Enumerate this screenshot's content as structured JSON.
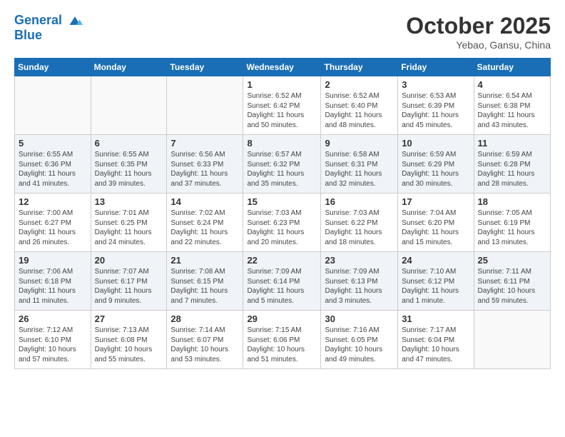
{
  "header": {
    "logo_line1": "General",
    "logo_line2": "Blue",
    "month": "October 2025",
    "location": "Yebao, Gansu, China"
  },
  "weekdays": [
    "Sunday",
    "Monday",
    "Tuesday",
    "Wednesday",
    "Thursday",
    "Friday",
    "Saturday"
  ],
  "weeks": [
    [
      {
        "day": "",
        "sunrise": "",
        "sunset": "",
        "daylight": ""
      },
      {
        "day": "",
        "sunrise": "",
        "sunset": "",
        "daylight": ""
      },
      {
        "day": "",
        "sunrise": "",
        "sunset": "",
        "daylight": ""
      },
      {
        "day": "1",
        "sunrise": "Sunrise: 6:52 AM",
        "sunset": "Sunset: 6:42 PM",
        "daylight": "Daylight: 11 hours and 50 minutes."
      },
      {
        "day": "2",
        "sunrise": "Sunrise: 6:52 AM",
        "sunset": "Sunset: 6:40 PM",
        "daylight": "Daylight: 11 hours and 48 minutes."
      },
      {
        "day": "3",
        "sunrise": "Sunrise: 6:53 AM",
        "sunset": "Sunset: 6:39 PM",
        "daylight": "Daylight: 11 hours and 45 minutes."
      },
      {
        "day": "4",
        "sunrise": "Sunrise: 6:54 AM",
        "sunset": "Sunset: 6:38 PM",
        "daylight": "Daylight: 11 hours and 43 minutes."
      }
    ],
    [
      {
        "day": "5",
        "sunrise": "Sunrise: 6:55 AM",
        "sunset": "Sunset: 6:36 PM",
        "daylight": "Daylight: 11 hours and 41 minutes."
      },
      {
        "day": "6",
        "sunrise": "Sunrise: 6:55 AM",
        "sunset": "Sunset: 6:35 PM",
        "daylight": "Daylight: 11 hours and 39 minutes."
      },
      {
        "day": "7",
        "sunrise": "Sunrise: 6:56 AM",
        "sunset": "Sunset: 6:33 PM",
        "daylight": "Daylight: 11 hours and 37 minutes."
      },
      {
        "day": "8",
        "sunrise": "Sunrise: 6:57 AM",
        "sunset": "Sunset: 6:32 PM",
        "daylight": "Daylight: 11 hours and 35 minutes."
      },
      {
        "day": "9",
        "sunrise": "Sunrise: 6:58 AM",
        "sunset": "Sunset: 6:31 PM",
        "daylight": "Daylight: 11 hours and 32 minutes."
      },
      {
        "day": "10",
        "sunrise": "Sunrise: 6:59 AM",
        "sunset": "Sunset: 6:29 PM",
        "daylight": "Daylight: 11 hours and 30 minutes."
      },
      {
        "day": "11",
        "sunrise": "Sunrise: 6:59 AM",
        "sunset": "Sunset: 6:28 PM",
        "daylight": "Daylight: 11 hours and 28 minutes."
      }
    ],
    [
      {
        "day": "12",
        "sunrise": "Sunrise: 7:00 AM",
        "sunset": "Sunset: 6:27 PM",
        "daylight": "Daylight: 11 hours and 26 minutes."
      },
      {
        "day": "13",
        "sunrise": "Sunrise: 7:01 AM",
        "sunset": "Sunset: 6:25 PM",
        "daylight": "Daylight: 11 hours and 24 minutes."
      },
      {
        "day": "14",
        "sunrise": "Sunrise: 7:02 AM",
        "sunset": "Sunset: 6:24 PM",
        "daylight": "Daylight: 11 hours and 22 minutes."
      },
      {
        "day": "15",
        "sunrise": "Sunrise: 7:03 AM",
        "sunset": "Sunset: 6:23 PM",
        "daylight": "Daylight: 11 hours and 20 minutes."
      },
      {
        "day": "16",
        "sunrise": "Sunrise: 7:03 AM",
        "sunset": "Sunset: 6:22 PM",
        "daylight": "Daylight: 11 hours and 18 minutes."
      },
      {
        "day": "17",
        "sunrise": "Sunrise: 7:04 AM",
        "sunset": "Sunset: 6:20 PM",
        "daylight": "Daylight: 11 hours and 15 minutes."
      },
      {
        "day": "18",
        "sunrise": "Sunrise: 7:05 AM",
        "sunset": "Sunset: 6:19 PM",
        "daylight": "Daylight: 11 hours and 13 minutes."
      }
    ],
    [
      {
        "day": "19",
        "sunrise": "Sunrise: 7:06 AM",
        "sunset": "Sunset: 6:18 PM",
        "daylight": "Daylight: 11 hours and 11 minutes."
      },
      {
        "day": "20",
        "sunrise": "Sunrise: 7:07 AM",
        "sunset": "Sunset: 6:17 PM",
        "daylight": "Daylight: 11 hours and 9 minutes."
      },
      {
        "day": "21",
        "sunrise": "Sunrise: 7:08 AM",
        "sunset": "Sunset: 6:15 PM",
        "daylight": "Daylight: 11 hours and 7 minutes."
      },
      {
        "day": "22",
        "sunrise": "Sunrise: 7:09 AM",
        "sunset": "Sunset: 6:14 PM",
        "daylight": "Daylight: 11 hours and 5 minutes."
      },
      {
        "day": "23",
        "sunrise": "Sunrise: 7:09 AM",
        "sunset": "Sunset: 6:13 PM",
        "daylight": "Daylight: 11 hours and 3 minutes."
      },
      {
        "day": "24",
        "sunrise": "Sunrise: 7:10 AM",
        "sunset": "Sunset: 6:12 PM",
        "daylight": "Daylight: 11 hours and 1 minute."
      },
      {
        "day": "25",
        "sunrise": "Sunrise: 7:11 AM",
        "sunset": "Sunset: 6:11 PM",
        "daylight": "Daylight: 10 hours and 59 minutes."
      }
    ],
    [
      {
        "day": "26",
        "sunrise": "Sunrise: 7:12 AM",
        "sunset": "Sunset: 6:10 PM",
        "daylight": "Daylight: 10 hours and 57 minutes."
      },
      {
        "day": "27",
        "sunrise": "Sunrise: 7:13 AM",
        "sunset": "Sunset: 6:08 PM",
        "daylight": "Daylight: 10 hours and 55 minutes."
      },
      {
        "day": "28",
        "sunrise": "Sunrise: 7:14 AM",
        "sunset": "Sunset: 6:07 PM",
        "daylight": "Daylight: 10 hours and 53 minutes."
      },
      {
        "day": "29",
        "sunrise": "Sunrise: 7:15 AM",
        "sunset": "Sunset: 6:06 PM",
        "daylight": "Daylight: 10 hours and 51 minutes."
      },
      {
        "day": "30",
        "sunrise": "Sunrise: 7:16 AM",
        "sunset": "Sunset: 6:05 PM",
        "daylight": "Daylight: 10 hours and 49 minutes."
      },
      {
        "day": "31",
        "sunrise": "Sunrise: 7:17 AM",
        "sunset": "Sunset: 6:04 PM",
        "daylight": "Daylight: 10 hours and 47 minutes."
      },
      {
        "day": "",
        "sunrise": "",
        "sunset": "",
        "daylight": ""
      }
    ]
  ]
}
